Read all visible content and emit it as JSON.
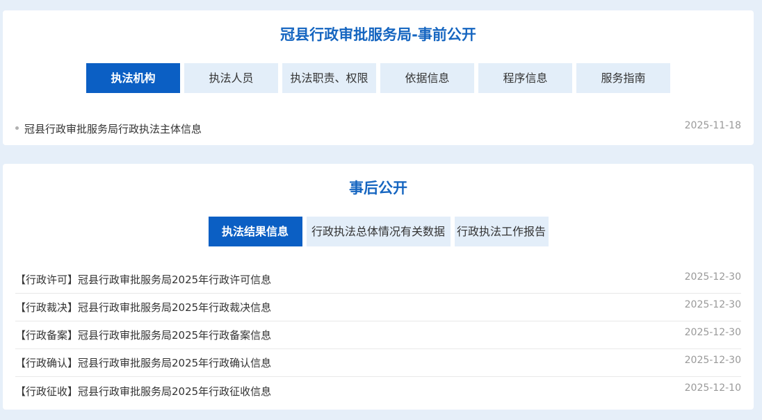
{
  "pre": {
    "title": "冠县行政审批服务局-事前公开",
    "tabs": [
      {
        "label": "执法机构",
        "active": true
      },
      {
        "label": "执法人员",
        "active": false
      },
      {
        "label": "执法职责、权限",
        "active": false
      },
      {
        "label": "依据信息",
        "active": false
      },
      {
        "label": "程序信息",
        "active": false
      },
      {
        "label": "服务指南",
        "active": false
      }
    ],
    "items": [
      {
        "title": "冠县行政审批服务局行政执法主体信息",
        "date": "2025-11-18"
      }
    ]
  },
  "post": {
    "title": "事后公开",
    "tabs": [
      {
        "label": "执法结果信息",
        "active": true
      },
      {
        "label": "行政执法总体情况有关数据",
        "active": false
      },
      {
        "label": "行政执法工作报告",
        "active": false
      }
    ],
    "items": [
      {
        "title": "【行政许可】冠县行政审批服务局2025年行政许可信息",
        "date": "2025-12-30"
      },
      {
        "title": "【行政裁决】冠县行政审批服务局2025年行政裁决信息",
        "date": "2025-12-30"
      },
      {
        "title": "【行政备案】冠县行政审批服务局2025年行政备案信息",
        "date": "2025-12-30"
      },
      {
        "title": "【行政确认】冠县行政审批服务局2025年行政确认信息",
        "date": "2025-12-30"
      },
      {
        "title": "【行政征收】冠县行政审批服务局2025年行政征收信息",
        "date": "2025-12-10"
      }
    ]
  },
  "colors": {
    "accent": "#0b5fc4",
    "title": "#1565c0",
    "tab_bg": "#e3eef9",
    "page_bg": "#e6eff9"
  }
}
